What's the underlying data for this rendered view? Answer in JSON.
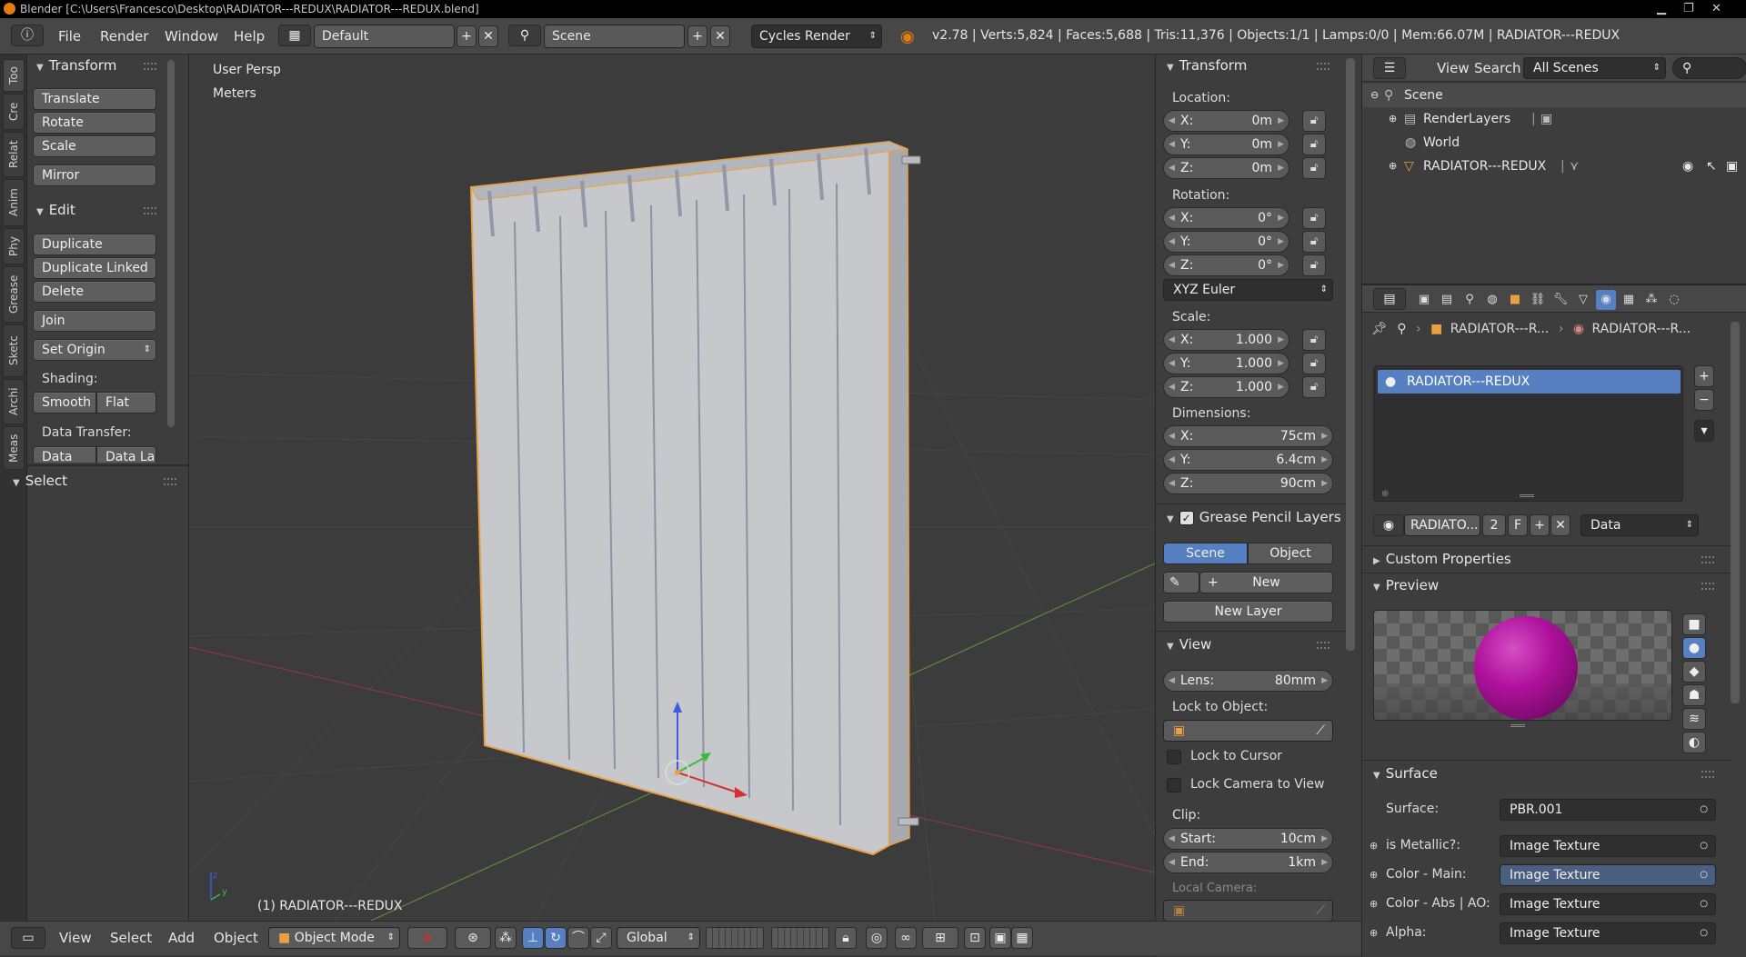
{
  "window": {
    "title": "Blender [C:\\Users\\Francesco\\Desktop\\RADIATOR---REDUX\\RADIATOR---REDUX.blend]"
  },
  "menu": {
    "file": "File",
    "render": "Render",
    "window": "Window",
    "help": "Help"
  },
  "header": {
    "layout": "Default",
    "scene": "Scene",
    "engine": "Cycles Render",
    "stats": "v2.78 | Verts:5,824 | Faces:5,688 | Tris:11,376 | Objects:1/1 | Lamps:0/0 | Mem:66.07M | RADIATOR---REDUX"
  },
  "tabs": [
    "Too",
    "Cre",
    "Relat",
    "Anim",
    "Phy",
    "Grease",
    "Sketc",
    "Archi",
    "Meas"
  ],
  "toolshelf": {
    "transform": {
      "title": "Transform",
      "translate": "Translate",
      "rotate": "Rotate",
      "scale": "Scale",
      "mirror": "Mirror"
    },
    "edit": {
      "title": "Edit",
      "duplicate": "Duplicate",
      "duplicate_linked": "Duplicate Linked",
      "delete": "Delete",
      "join": "Join",
      "set_origin": "Set Origin"
    },
    "shading": {
      "label": "Shading:",
      "smooth": "Smooth",
      "flat": "Flat"
    },
    "data_transfer": {
      "label": "Data Transfer:",
      "data": "Data",
      "data_layout": "Data La"
    },
    "select": {
      "title": "Select"
    }
  },
  "viewport": {
    "view_name": "User Persp",
    "units": "Meters",
    "object_label": "(1) RADIATOR---REDUX"
  },
  "npanel": {
    "transform_title": "Transform",
    "location": {
      "label": "Location:",
      "x": "0m",
      "y": "0m",
      "z": "0m"
    },
    "rotation": {
      "label": "Rotation:",
      "x": "0°",
      "y": "0°",
      "z": "0°",
      "mode": "XYZ Euler"
    },
    "scale": {
      "label": "Scale:",
      "x": "1.000",
      "y": "1.000",
      "z": "1.000"
    },
    "dimensions": {
      "label": "Dimensions:",
      "x": "75cm",
      "y": "6.4cm",
      "z": "90cm"
    },
    "axis_x": "X:",
    "axis_y": "Y:",
    "axis_z": "Z:",
    "grease": {
      "title": "Grease Pencil Layers",
      "scene": "Scene",
      "object": "Object",
      "new": "New",
      "new_layer": "New Layer"
    },
    "view": {
      "title": "View",
      "lens_label": "Lens:",
      "lens": "80mm",
      "lock_to_object": "Lock to Object:",
      "lock_cursor": "Lock to Cursor",
      "lock_camera": "Lock Camera to View",
      "clip": "Clip:",
      "start_label": "Start:",
      "start": "10cm",
      "end_label": "End:",
      "end": "1km",
      "local_camera": "Local Camera:"
    }
  },
  "outliner": {
    "view": "View",
    "search": "Search",
    "filter": "All Scenes",
    "items": [
      "Scene",
      "RenderLayers",
      "World",
      "RADIATOR---REDUX"
    ]
  },
  "properties": {
    "breadcrumb": [
      "RADIATOR---R...",
      "RADIATOR---R..."
    ],
    "material_slot": "RADIATOR---REDUX",
    "material_name": "RADIATO...",
    "users": "2",
    "fake": "F",
    "link": "Data",
    "custom_properties": "Custom Properties",
    "preview": "Preview",
    "surface_title": "Surface",
    "surface_label": "Surface:",
    "surface_value": "PBR.001",
    "inputs": [
      {
        "label": "is Metallic?:",
        "value": "Image Texture"
      },
      {
        "label": "Color - Main:",
        "value": "Image Texture"
      },
      {
        "label": "Color - Abs | AO:",
        "value": "Image Texture"
      },
      {
        "label": "Alpha:",
        "value": "Image Texture"
      }
    ]
  },
  "bottombar": {
    "view": "View",
    "select": "Select",
    "add": "Add",
    "object": "Object",
    "mode": "Object Mode",
    "orientation": "Global"
  },
  "colors": {
    "selected_blue": "#5680c2",
    "outline_orange": "#e8a040",
    "material_purple": "#b0119c"
  }
}
